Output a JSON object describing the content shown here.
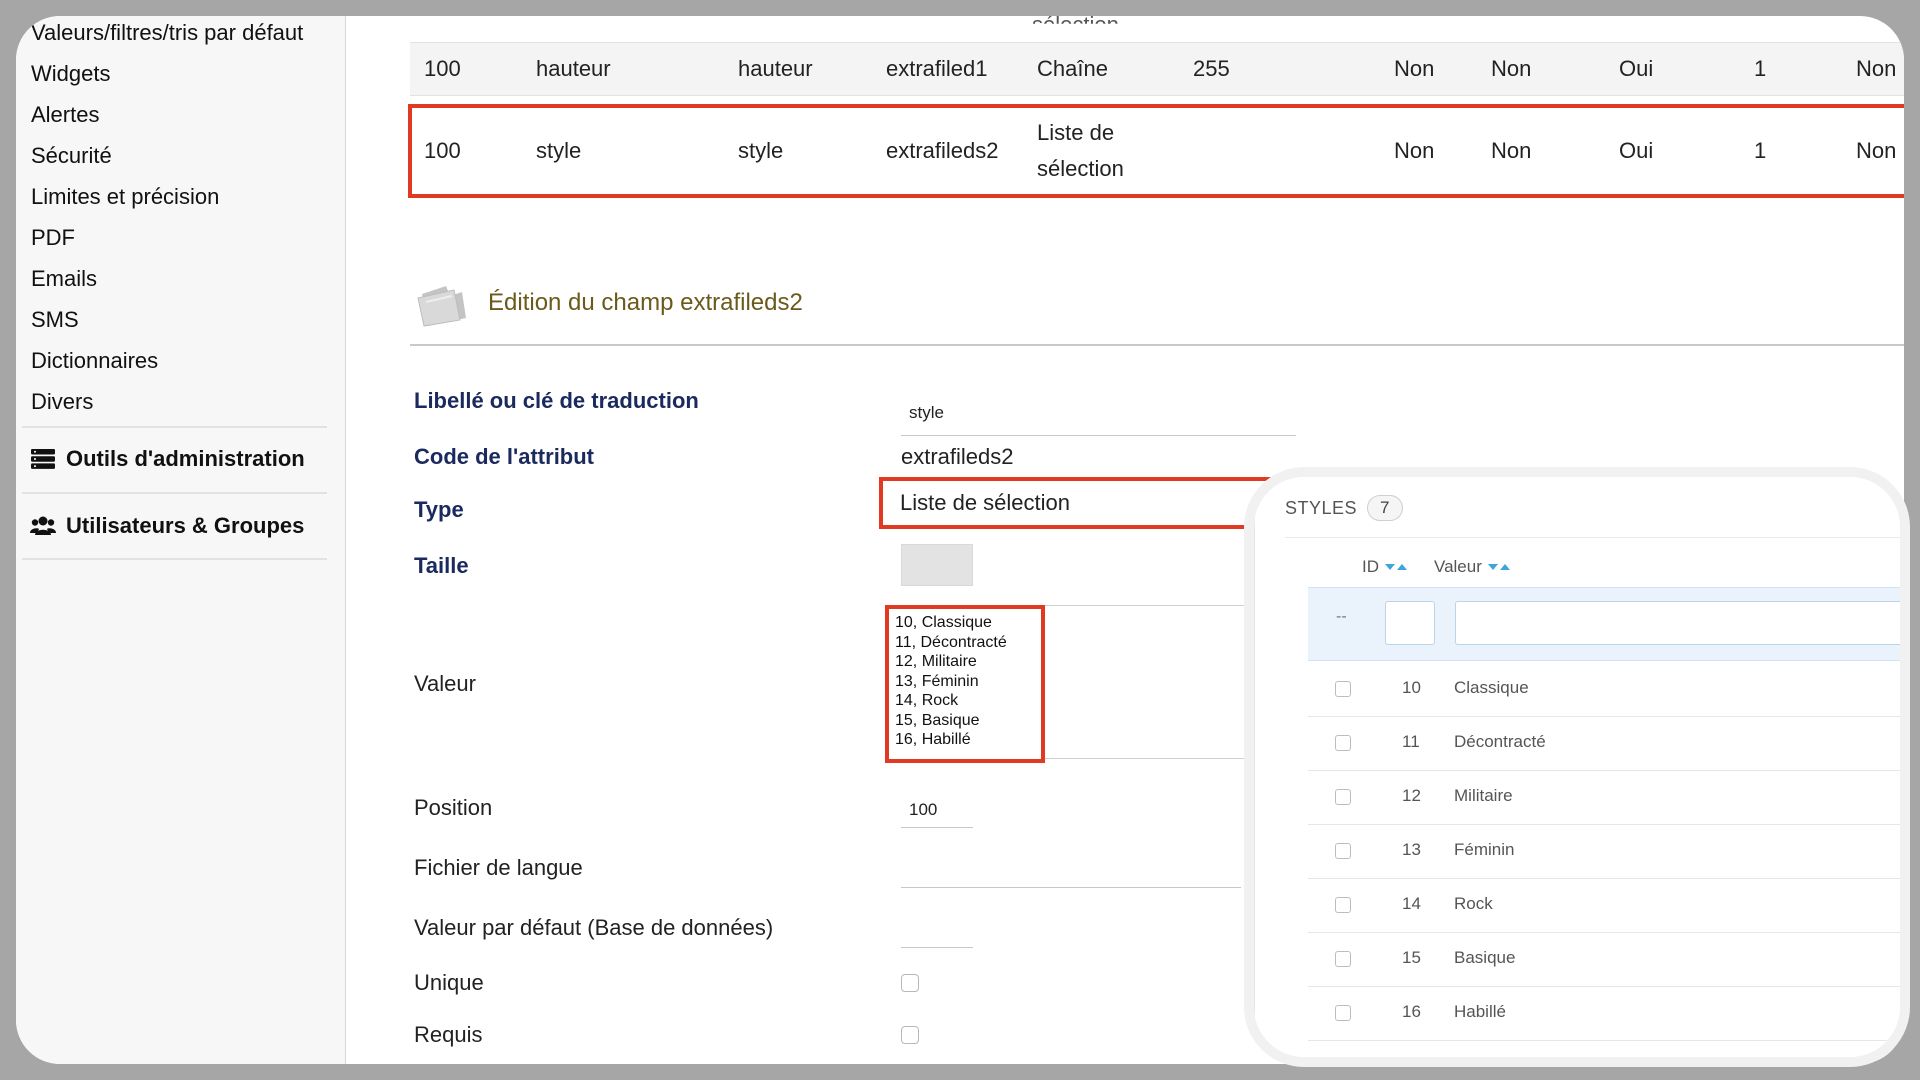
{
  "sidebar": {
    "items": [
      "Valeurs/filtres/tris par défaut",
      "Widgets",
      "Alertes",
      "Sécurité",
      "Limites et précision",
      "PDF",
      "Emails",
      "SMS",
      "Dictionnaires",
      "Divers"
    ],
    "sections": [
      "Outils d'administration",
      "Utilisateurs & Groupes"
    ]
  },
  "extrafields_table": {
    "partial_row_text": "sélection",
    "rows": [
      [
        "100",
        "hauteur",
        "hauteur",
        "extrafiled1",
        "Chaîne",
        "255",
        "Non",
        "Non",
        "Oui",
        "1",
        "Non"
      ],
      [
        "100",
        "style",
        "style",
        "extrafileds2",
        "Liste de sélection",
        "",
        "Non",
        "Non",
        "Oui",
        "1",
        "Non"
      ]
    ]
  },
  "edit_section": {
    "title": "Édition du champ extrafileds2"
  },
  "form": {
    "label_label": "Libellé ou clé de traduction",
    "label_value": "style",
    "code_label": "Code de l'attribut",
    "code_value": "extrafileds2",
    "type_label": "Type",
    "type_value": "Liste de sélection",
    "size_label": "Taille",
    "value_label": "Valeur",
    "value_lines": [
      "10, Classique",
      "11, Décontracté",
      "12, Militaire",
      "13, Féminin",
      "14, Rock",
      "15, Basique",
      "16, Habillé"
    ],
    "position_label": "Position",
    "position_value": "100",
    "langfile_label": "Fichier de langue",
    "default_label": "Valeur par défaut (Base de données)",
    "unique_label": "Unique",
    "required_label": "Requis"
  },
  "styles_panel": {
    "title": "STYLES",
    "count": "7",
    "col_id": "ID",
    "col_value": "Valeur",
    "filter_dash": "--",
    "rows": [
      {
        "id": "10",
        "value": "Classique"
      },
      {
        "id": "11",
        "value": "Décontracté"
      },
      {
        "id": "12",
        "value": "Militaire"
      },
      {
        "id": "13",
        "value": "Féminin"
      },
      {
        "id": "14",
        "value": "Rock"
      },
      {
        "id": "15",
        "value": "Basique"
      },
      {
        "id": "16",
        "value": "Habillé"
      }
    ]
  },
  "colors": {
    "highlight": "#e03a22",
    "required_label": "#1b2a5e",
    "section_title": "#6b5a1c",
    "sort_arrow": "#3aa6dc"
  }
}
